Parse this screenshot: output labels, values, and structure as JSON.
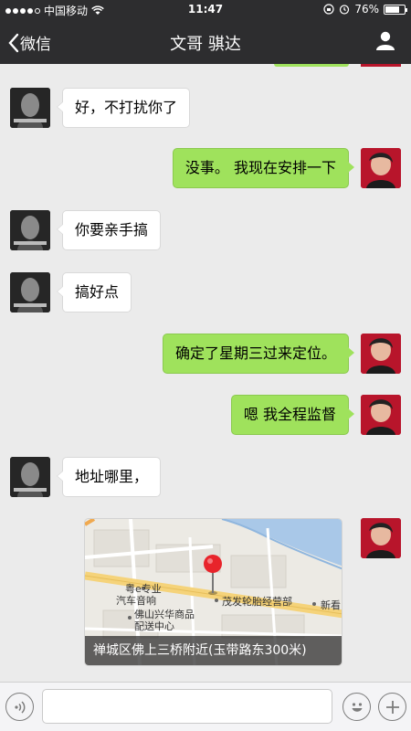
{
  "status_bar": {
    "carrier": "中国移动",
    "time": "11:47",
    "battery": "76%",
    "battery_level": 0.76
  },
  "nav": {
    "back_label": "微信",
    "title": "文哥  骐达"
  },
  "messages": [
    {
      "side": "left",
      "text": "好，不打扰你了"
    },
    {
      "side": "right",
      "text": "没事。 我现在安排一下"
    },
    {
      "side": "left",
      "text": "你要亲手搞"
    },
    {
      "side": "left",
      "text": "搞好点"
    },
    {
      "side": "right",
      "text": "确定了星期三过来定位。"
    },
    {
      "side": "right",
      "text": "嗯 我全程监督"
    },
    {
      "side": "left",
      "text": "地址哪里，"
    }
  ],
  "location": {
    "address": "禅城区佛上三桥附近(玉带路东300米)",
    "map_labels": {
      "shop1_line1": "粤e专业",
      "shop1_line2": "汽车音响",
      "shop2": "茂发轮胎经营部",
      "shop3_line1": "佛山兴华商品",
      "shop3_line2": "配送中心",
      "shop4": "新看"
    }
  },
  "input_bar": {
    "placeholder": ""
  },
  "colors": {
    "nav_bg": "#2d2d2f",
    "bubble_green": "#9fe25c",
    "chat_bg": "#ebebeb",
    "pin_red": "#e8242b"
  }
}
